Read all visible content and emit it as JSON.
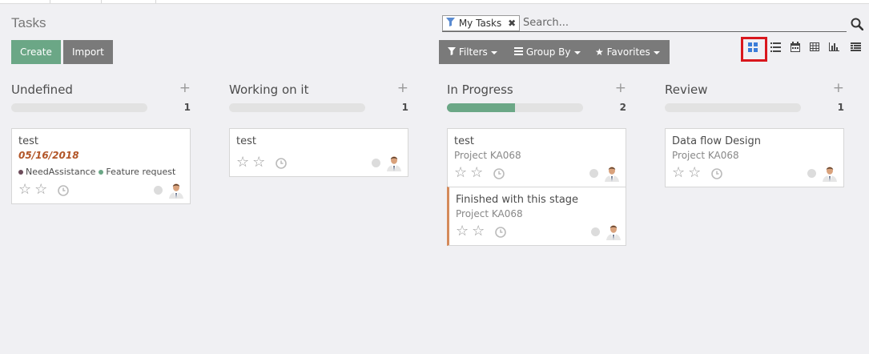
{
  "window": {
    "tabs": [
      "",
      "",
      ""
    ]
  },
  "control_panel": {
    "title": "Tasks",
    "create_label": "Create",
    "import_label": "Import",
    "search": {
      "facet_label": "My Tasks",
      "facet_icon": "filter-icon",
      "placeholder": "Search..."
    },
    "filters_label": "Filters",
    "group_by_label": "Group By",
    "favorites_label": "Favorites",
    "views": [
      "kanban-view-icon",
      "list-view-icon",
      "calendar-view-icon",
      "pivot-view-icon",
      "graph-view-icon",
      "activity-view-icon"
    ],
    "active_view": "kanban",
    "highlight_color": "#d9171d"
  },
  "columns": [
    {
      "title": "Undefined",
      "count": "1",
      "progress": 0,
      "cards": [
        {
          "title": "test",
          "date": "05/16/2018",
          "tags": [
            {
              "label": "NeedAssistance",
              "color": "#6d4c5a"
            },
            {
              "label": "Feature request",
              "color": "#6ba786"
            }
          ],
          "priority": 0
        }
      ]
    },
    {
      "title": "Working on it",
      "count": "1",
      "progress": 0,
      "cards": [
        {
          "title": "test",
          "priority": 0
        }
      ]
    },
    {
      "title": "In Progress",
      "count": "2",
      "progress": 0.5,
      "cards": [
        {
          "title": "test",
          "project": "Project KA068",
          "priority": 0
        },
        {
          "title": "Finished with this stage",
          "project": "Project KA068",
          "priority": 0,
          "accent_color": "#d48a5a"
        }
      ]
    },
    {
      "title": "Review",
      "count": "1",
      "progress": 0,
      "cards": [
        {
          "title": "Data flow Design",
          "project": "Project KA068",
          "priority": 0
        }
      ]
    }
  ],
  "colors": {
    "primary": "#6ba786",
    "secondary": "#7a7a7a",
    "background": "#f0f0f3",
    "date": "#b25527"
  }
}
